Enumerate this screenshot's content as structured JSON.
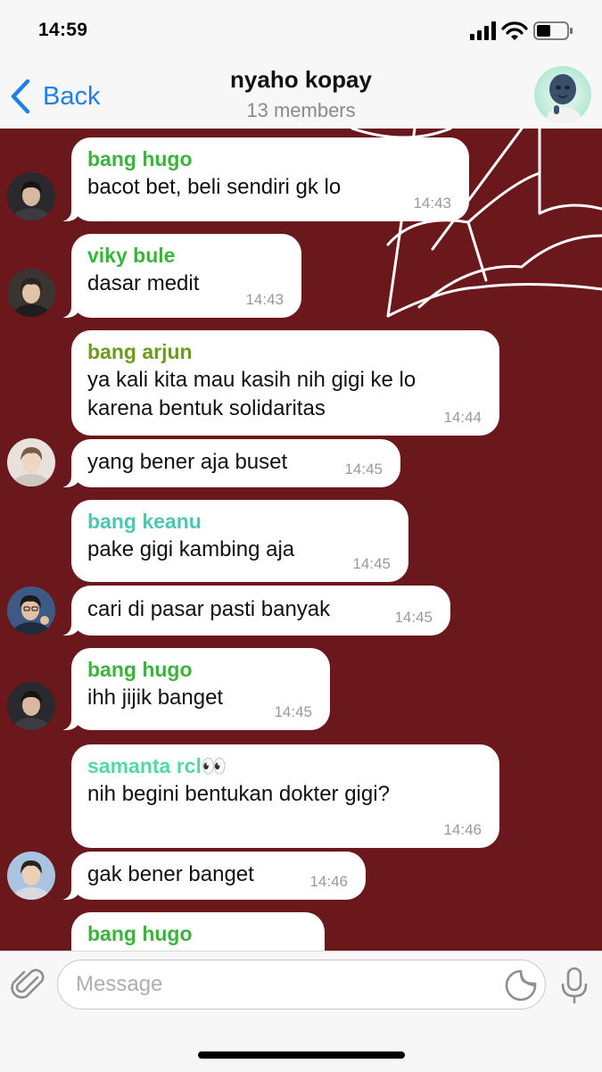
{
  "status_bar": {
    "time": "14:59"
  },
  "header": {
    "back_label": "Back",
    "title": "nyaho kopay",
    "subtitle": "13 members"
  },
  "messages": [
    {
      "sender": "bang hugo",
      "sender_color": "#3cb43c",
      "lines": [
        "bacot bet, beli sendiri gk lo"
      ],
      "time": "14:43",
      "avatar": "hugo"
    },
    {
      "sender": "viky bule",
      "sender_color": "#3cb43c",
      "lines": [
        "dasar medit"
      ],
      "time": "14:43",
      "avatar": "viky"
    },
    {
      "sender": "bang arjun",
      "sender_color": "#6e9b1a",
      "lines": [
        "ya kali kita mau kasih nih gigi ke lo",
        "karena bentuk solidaritas"
      ],
      "time": "14:44"
    },
    {
      "sender": "",
      "lines": [
        "yang bener aja buset"
      ],
      "time": "14:45",
      "avatar": "arjun"
    },
    {
      "sender": "bang keanu",
      "sender_color": "#4ec7b0",
      "lines": [
        "pake gigi kambing aja"
      ],
      "time": "14:45"
    },
    {
      "sender": "",
      "lines": [
        "cari di pasar pasti banyak"
      ],
      "time": "14:45",
      "avatar": "keanu"
    },
    {
      "sender": "bang hugo",
      "sender_color": "#3cb43c",
      "lines": [
        "ihh jijik banget"
      ],
      "time": "14:45",
      "avatar": "hugo"
    },
    {
      "sender": "samanta rcl👀",
      "sender_color": "#55d8a8",
      "lines": [
        "nih begini bentukan dokter gigi?"
      ],
      "time": "14:46"
    },
    {
      "sender": "",
      "lines": [
        "gak bener banget"
      ],
      "time": "14:46",
      "avatar": "samanta"
    },
    {
      "sender": "bang hugo",
      "sender_color": "#3cb43c",
      "lines": [],
      "time": ""
    }
  ],
  "input": {
    "placeholder": "Message"
  },
  "colors": {
    "accent": "#1e7fe6",
    "chat_background": "#6a181b",
    "bubble": "#ffffff"
  }
}
